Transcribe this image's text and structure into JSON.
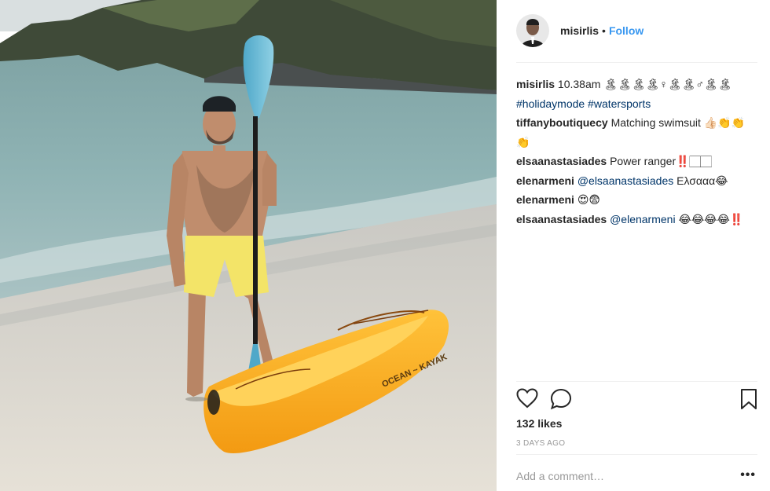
{
  "post": {
    "username": "misirlis",
    "dot": "•",
    "follow_label": "Follow",
    "photo_alt": "",
    "comments": [
      {
        "user": "misirlis",
        "text": "10.38am 🏝🏝🏝🏝♀🏝🏝♂🏝🏝",
        "tags": "#holidaymode #watersports"
      },
      {
        "user": "tiffanyboutiquecy",
        "text": "Matching swimsuit 👍🏻👏👏👏",
        "tags": ""
      },
      {
        "user": "elsaanastasiades",
        "text": "Power ranger‼️🏻🏻",
        "tags": ""
      },
      {
        "user": "elenarmeni",
        "mention": "@elsaanastasiades",
        "text": "Ελσααα😂",
        "tags": ""
      },
      {
        "user": "elenarmeni",
        "text": "😍😨",
        "tags": ""
      },
      {
        "user": "elsaanastasiades",
        "mention": "@elenarmeni",
        "text": "😂😂😂😂‼️",
        "tags": ""
      }
    ],
    "likes": "132 likes",
    "timestamp": "3 DAYS AGO",
    "add_comment_placeholder": "Add a comment…",
    "more_label": "•••",
    "icons": [
      "heart-icon",
      "comment-icon",
      "bookmark-icon"
    ]
  }
}
